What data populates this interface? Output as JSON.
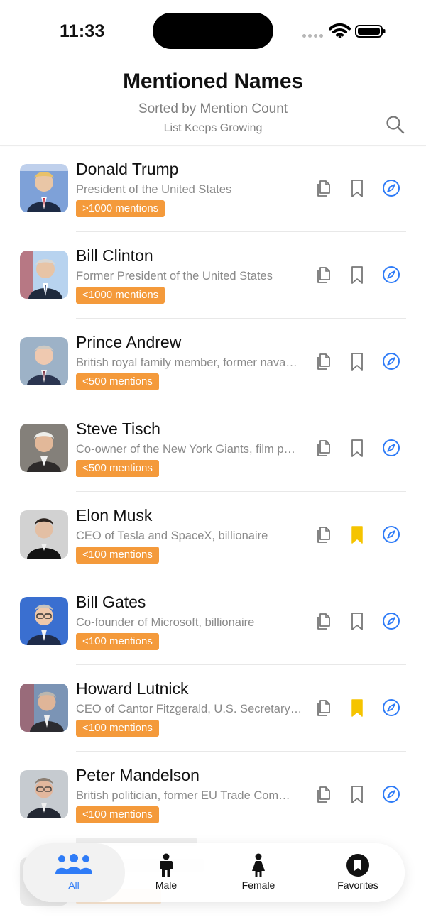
{
  "status_bar": {
    "time": "11:33"
  },
  "header": {
    "title": "Mentioned Names",
    "subtitle": "Sorted by Mention Count",
    "caption": "List Keeps Growing",
    "search_icon": "magnifying-glass-icon"
  },
  "list": [
    {
      "name": "Donald Trump",
      "description": "President of the United States",
      "badge": ">1000 mentions",
      "bookmarked": false,
      "avatar_bg": "#7ea1d8"
    },
    {
      "name": "Bill Clinton",
      "description": "Former President of the United States",
      "badge": "<1000 mentions",
      "bookmarked": false,
      "avatar_bg": "#b8d3ef"
    },
    {
      "name": "Prince Andrew",
      "description": "British royal family member, former nava…",
      "badge": "<500 mentions",
      "bookmarked": false,
      "avatar_bg": "#9db2c7"
    },
    {
      "name": "Steve Tisch",
      "description": "Co-owner of the New York Giants, film p…",
      "badge": "<500 mentions",
      "bookmarked": false,
      "avatar_bg": "#84807a"
    },
    {
      "name": "Elon Musk",
      "description": "CEO of Tesla and SpaceX, billionaire",
      "badge": "<100 mentions",
      "bookmarked": true,
      "avatar_bg": "#bdbdbd"
    },
    {
      "name": "Bill Gates",
      "description": "Co-founder of Microsoft, billionaire",
      "badge": "<100 mentions",
      "bookmarked": false,
      "avatar_bg": "#3a6fd0"
    },
    {
      "name": "Howard Lutnick",
      "description": "CEO of Cantor Fitzgerald, U.S. Secretary…",
      "badge": "<100 mentions",
      "bookmarked": true,
      "avatar_bg": "#7b94b5"
    },
    {
      "name": "Peter Mandelson",
      "description": "British politician, former EU Trade Com…",
      "badge": "<100 mentions",
      "bookmarked": false,
      "avatar_bg": "#c6cbd0"
    }
  ],
  "tabs": [
    {
      "label": "All",
      "icon": "people-group-icon",
      "selected": true
    },
    {
      "label": "Male",
      "icon": "male-person-icon",
      "selected": false
    },
    {
      "label": "Female",
      "icon": "female-person-icon",
      "selected": false
    },
    {
      "label": "Favorites",
      "icon": "bookmark-circle-icon",
      "selected": false
    }
  ],
  "colors": {
    "badge_orange": "#f49a3b",
    "bookmark_active": "#f5c400",
    "link_blue": "#2f7cf7",
    "tab_selected": "#2f7cf7"
  }
}
